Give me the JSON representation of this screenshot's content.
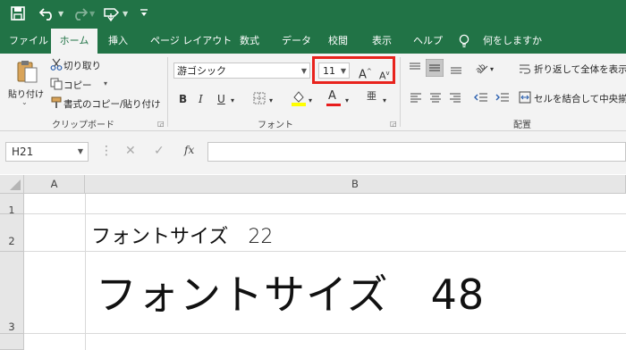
{
  "quick_access": {
    "icons": [
      "save-icon",
      "undo-icon",
      "redo-icon",
      "touch-mode-icon",
      "customize-icon"
    ]
  },
  "tabs": [
    "ファイル",
    "ホーム",
    "挿入",
    "ページ レイアウト",
    "数式",
    "データ",
    "校閲",
    "表示",
    "ヘルプ"
  ],
  "tell_me": "何をしますか",
  "clipboard": {
    "paste_label": "貼り付け",
    "cut_label": "切り取り",
    "copy_label": "コピー",
    "format_painter_label": "書式のコピー/貼り付け",
    "group_label": "クリップボード"
  },
  "font": {
    "font_name": "游ゴシック",
    "font_size": "11",
    "increase_label": "A",
    "decrease_label": "A",
    "bold": "B",
    "italic": "I",
    "underline": "U",
    "font_color_letter": "A",
    "phonetic_letter": "亜",
    "group_label": "フォント"
  },
  "alignment": {
    "wrap_text_label": "折り返して全体を表示",
    "merge_label": "セルを結合して中央揃",
    "group_label": "配置"
  },
  "formula_bar": {
    "name_box": "H21",
    "fx_label": "fx",
    "formula": ""
  },
  "grid": {
    "columns": [
      "A",
      "B"
    ],
    "rows": [
      "1",
      "2",
      "3"
    ],
    "cells": {
      "b2": "フォントサイズ　22",
      "b3": "フォントサイズ　48"
    }
  },
  "colors": {
    "excel_green": "#217346",
    "highlight_red": "#e8231d",
    "fill_yellow": "#ffff00",
    "font_red": "#e81c1c"
  }
}
